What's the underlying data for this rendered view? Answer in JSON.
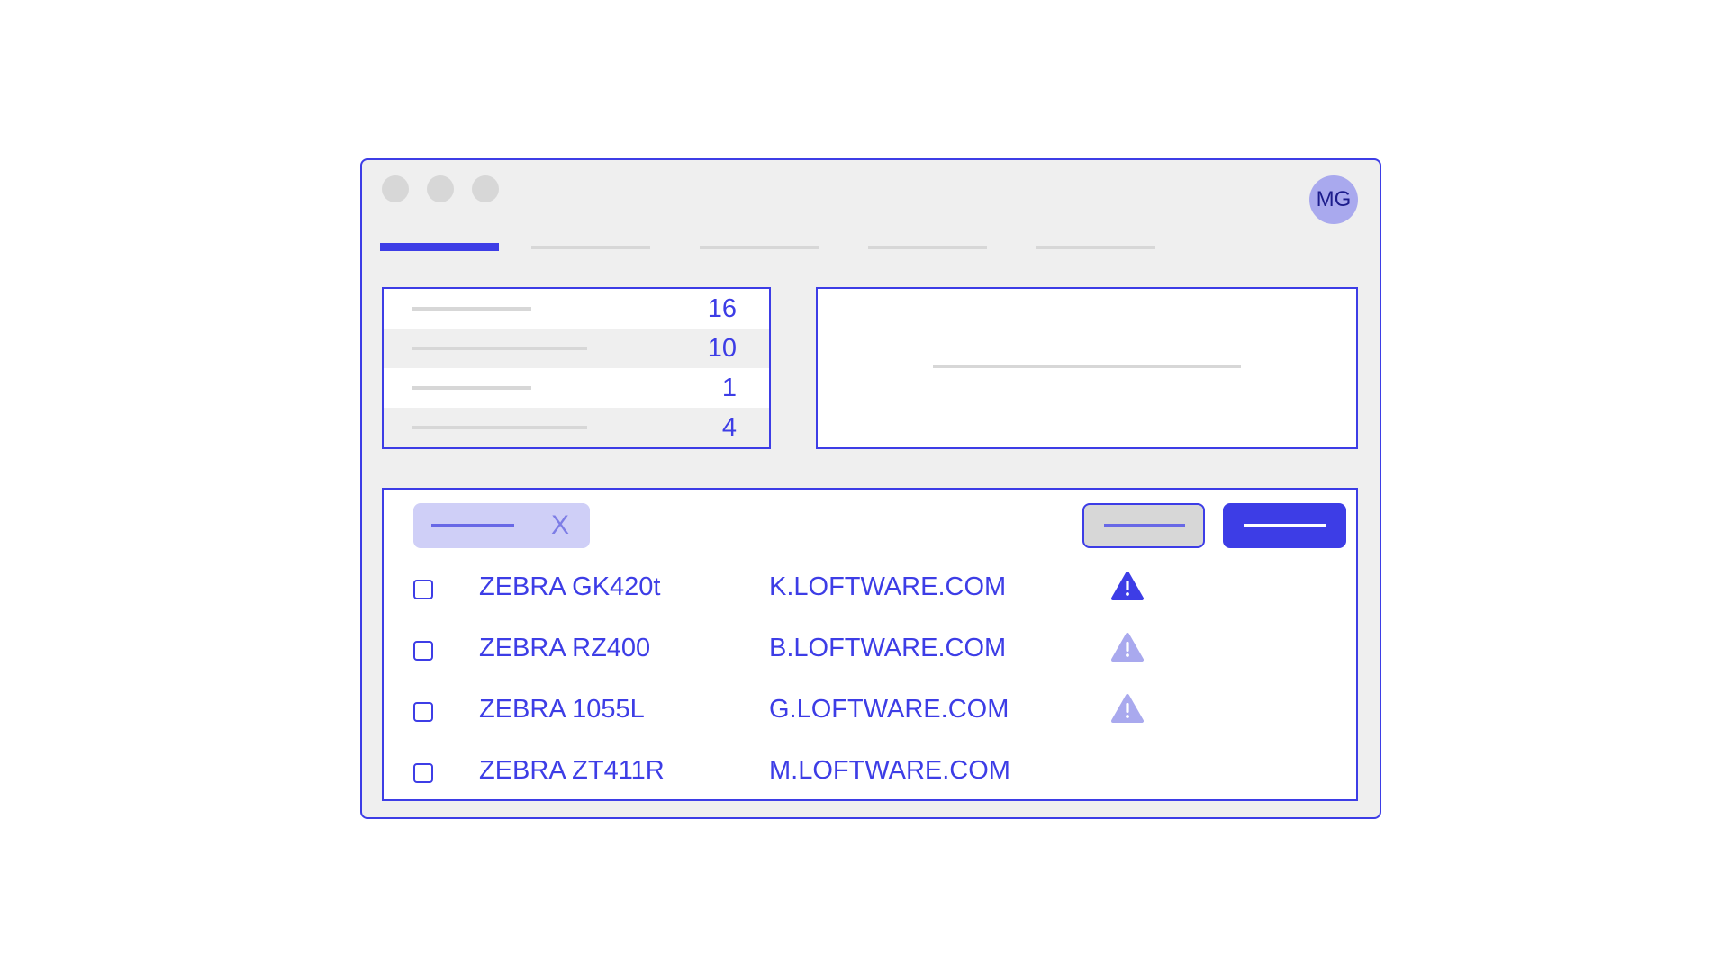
{
  "header": {
    "avatar_initials": "MG",
    "window_controls": [
      "close",
      "minimize",
      "maximize"
    ],
    "tabs_count": 5,
    "active_tab_index": 0
  },
  "stats": [
    {
      "value": "16"
    },
    {
      "value": "10"
    },
    {
      "value": "1"
    },
    {
      "value": "4"
    }
  ],
  "filter_chip": {
    "clear_label": "X"
  },
  "printers": [
    {
      "name": "ZEBRA GK420t",
      "host": "K.LOFTWARE.COM",
      "warning": "active"
    },
    {
      "name": "ZEBRA RZ400",
      "host": "B.LOFTWARE.COM",
      "warning": "muted"
    },
    {
      "name": "ZEBRA 1055L",
      "host": "G.LOFTWARE.COM",
      "warning": "muted"
    },
    {
      "name": "ZEBRA ZT411R",
      "host": "M.LOFTWARE.COM",
      "warning": "none"
    }
  ],
  "colors": {
    "accent": "#3d3de6",
    "accent_light": "#a9a9ee",
    "placeholder_gray": "#d7d7d7",
    "window_bg": "#efefef",
    "warning_active": "#3d3de6",
    "warning_muted": "#a9a9ee"
  }
}
